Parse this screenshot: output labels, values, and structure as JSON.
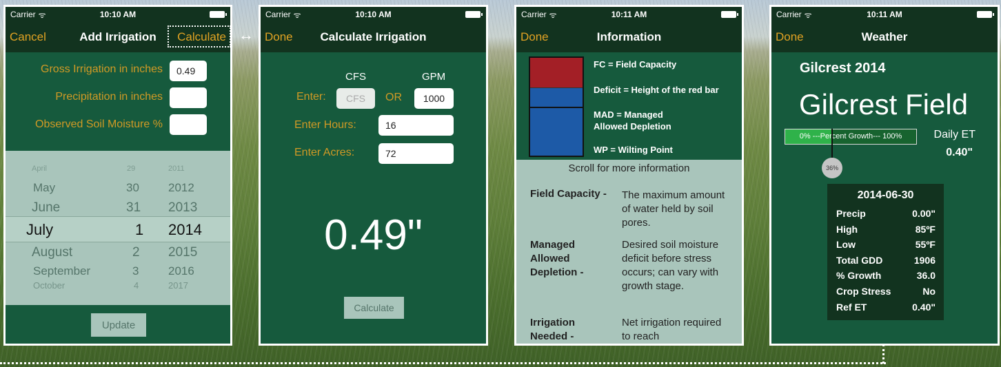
{
  "status": {
    "carrier": "Carrier",
    "times": [
      "10:10 AM",
      "10:10 AM",
      "10:11 AM",
      "10:11 AM"
    ]
  },
  "screen1": {
    "nav": {
      "left": "Cancel",
      "title": "Add Irrigation",
      "right": "Calculate"
    },
    "fields": [
      {
        "label": "Gross Irrigation in inches",
        "value": "0.49"
      },
      {
        "label": "Precipitation in inches",
        "value": ""
      },
      {
        "label": "Observed Soil Moisture %",
        "value": ""
      }
    ],
    "picker": {
      "rows": [
        {
          "month": "April",
          "day": "29",
          "year": "2011"
        },
        {
          "month": "May",
          "day": "30",
          "year": "2012"
        },
        {
          "month": "June",
          "day": "31",
          "year": "2013"
        },
        {
          "month": "July",
          "day": "1",
          "year": "2014"
        },
        {
          "month": "August",
          "day": "2",
          "year": "2015"
        },
        {
          "month": "September",
          "day": "3",
          "year": "2016"
        },
        {
          "month": "October",
          "day": "4",
          "year": "2017"
        }
      ]
    },
    "update_label": "Update"
  },
  "screen2": {
    "nav": {
      "left": "Done",
      "title": "Calculate Irrigation"
    },
    "cfs_header": "CFS",
    "gpm_header": "GPM",
    "enter_label": "Enter:",
    "cfs_placeholder": "CFS",
    "or_label": "OR",
    "gpm_value": "1000",
    "hours_label": "Enter Hours:",
    "hours_value": "16",
    "acres_label": "Enter Acres:",
    "acres_value": "72",
    "result": "0.49\"",
    "calculate_label": "Calculate"
  },
  "screen3": {
    "nav": {
      "left": "Done",
      "title": "Information"
    },
    "legend": [
      "FC = Field Capacity",
      "Deficit = Height of the red bar",
      "MAD = Managed\nAllowed Depletion",
      "WP = Wilting Point"
    ],
    "scroll_text": "Scroll for more information",
    "defs": [
      {
        "term": "Field Capacity -",
        "def": "The maximum amount of water held by soil pores."
      },
      {
        "term": "Managed Allowed Depletion -",
        "def": "Desired soil moisture deficit before stress occurs; can vary with growth stage."
      },
      {
        "term": "Irrigation Needed -",
        "def": "Net irrigation required to reach"
      }
    ],
    "colors": {
      "red": "#a31f26",
      "blue": "#1d5aa7"
    }
  },
  "screen4": {
    "nav": {
      "left": "Done",
      "title": "Weather"
    },
    "location": "Gilcrest 2014",
    "field_name": "Gilcrest Field",
    "growth_bar_text": "0% ---Percent Growth--- 100%",
    "growth_percent": 36,
    "growth_badge": "36%",
    "daily_et_label": "Daily ET",
    "daily_et_value": "0.40\"",
    "date": "2014-06-30",
    "rows": [
      {
        "k": "Precip",
        "v": "0.00\""
      },
      {
        "k": "High",
        "v": "85ºF"
      },
      {
        "k": "Low",
        "v": "55ºF"
      },
      {
        "k": "Total GDD",
        "v": "1906"
      },
      {
        "k": "% Growth",
        "v": "36.0"
      },
      {
        "k": "Crop Stress",
        "v": "No"
      },
      {
        "k": "Ref ET",
        "v": "0.40\""
      }
    ]
  },
  "colors": {
    "accent": "#d19a25",
    "dark": "#12331f",
    "green": "#165a3d"
  }
}
